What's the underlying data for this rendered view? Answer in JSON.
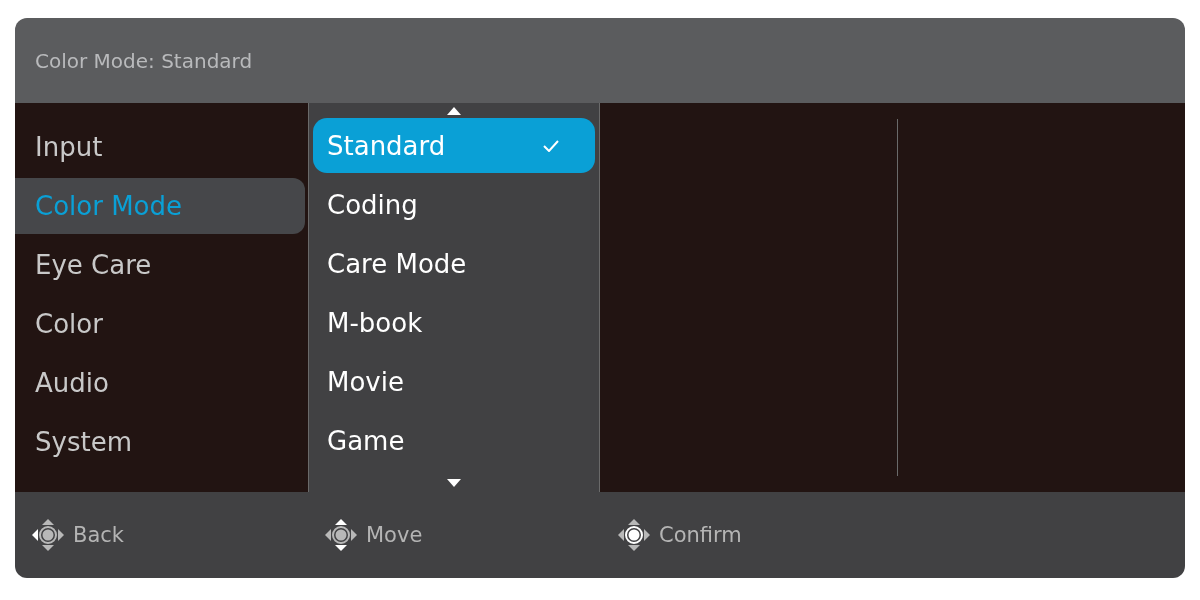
{
  "header": {
    "title": "Color Mode: Standard"
  },
  "menu": [
    {
      "label": "Input",
      "selected": false
    },
    {
      "label": "Color Mode",
      "selected": true
    },
    {
      "label": "Eye Care",
      "selected": false
    },
    {
      "label": "Color",
      "selected": false
    },
    {
      "label": "Audio",
      "selected": false
    },
    {
      "label": "System",
      "selected": false
    }
  ],
  "submenu": [
    {
      "label": "Standard",
      "selected": true
    },
    {
      "label": "Coding",
      "selected": false
    },
    {
      "label": "Care Mode",
      "selected": false
    },
    {
      "label": "M-book",
      "selected": false
    },
    {
      "label": "Movie",
      "selected": false
    },
    {
      "label": "Game",
      "selected": false
    }
  ],
  "footer": [
    {
      "label": "Back",
      "kind": "left"
    },
    {
      "label": "Move",
      "kind": "updown"
    },
    {
      "label": "Confirm",
      "kind": "center"
    }
  ]
}
